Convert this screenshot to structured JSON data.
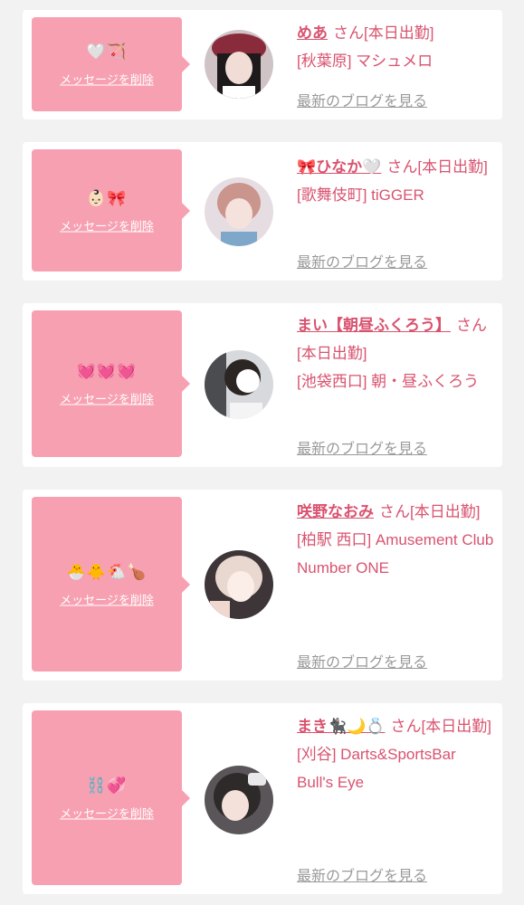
{
  "common": {
    "delete_label": "メッセージを削除",
    "blog_label": "最新のブログを見る",
    "san_suffix": "さん[本日出勤]"
  },
  "colors": {
    "bubble": "#f7a0b1",
    "name": "#d9536f",
    "link_gray": "#9a9a9a"
  },
  "messages": [
    {
      "emoji": "🤍🏹",
      "name": "めあ",
      "location": "[秋葉原] マシュメロ"
    },
    {
      "emoji": "👶🏻🎀",
      "name": "🎀ひなか🤍",
      "location": "[歌舞伎町] tiGGER"
    },
    {
      "emoji": "💓💓💓",
      "name": "まい【朝昼ふくろう】",
      "location": "[池袋西口] 朝・昼ふくろう"
    },
    {
      "emoji": "🐣🐥🐔🍗",
      "name": "咲野なおみ",
      "location": "[柏駅 西口] Amusement Club Number ONE"
    },
    {
      "emoji": "⛓️💞",
      "name": "まき🐈‍⬛🌙💍",
      "location": "[刈谷] Darts&SportsBar Bull's Eye"
    }
  ]
}
